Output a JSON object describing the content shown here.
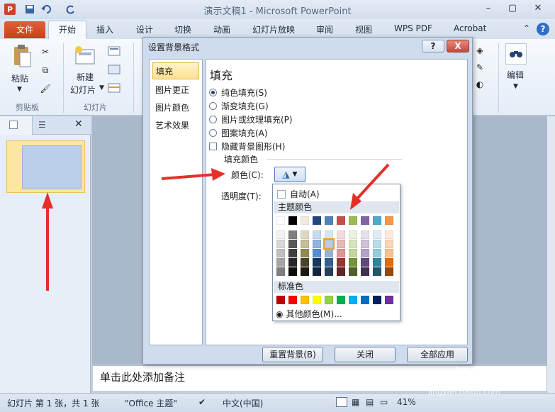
{
  "app": {
    "title": "演示文稿1 - Microsoft PowerPoint",
    "logo": "P"
  },
  "tabs": [
    "文件",
    "开始",
    "插入",
    "设计",
    "切换",
    "动画",
    "幻灯片放映",
    "审阅",
    "视图",
    "WPS PDF",
    "Acrobat"
  ],
  "ribbon": {
    "paste": "粘贴",
    "new_slide_1": "新建",
    "new_slide_2": "幻灯片",
    "edit": "编辑",
    "group_clipboard": "剪贴板",
    "group_slides": "幻灯片"
  },
  "dialog": {
    "title": "设置背景格式",
    "help": "?",
    "close": "X",
    "nav": [
      "填充",
      "图片更正",
      "图片颜色",
      "艺术效果"
    ],
    "main_title": "填充",
    "options": [
      "纯色填充(S)",
      "渐变填充(G)",
      "图片或纹理填充(P)",
      "图案填充(A)"
    ],
    "hide_graphics": "隐藏背景图形(H)",
    "fill_color_section": "填充颜色",
    "color_label": "颜色(C):",
    "transparency_label": "透明度(T):",
    "btn_reset": "重置背景(B)",
    "btn_close": "关闭",
    "btn_apply_all": "全部应用"
  },
  "palette": {
    "auto": "自动(A)",
    "theme_colors": "主题颜色",
    "standard_colors": "标准色",
    "more_colors": "其他颜色(M)...",
    "theme_top": [
      "#ffffff",
      "#000000",
      "#eeece1",
      "#1f497d",
      "#4f81bd",
      "#c0504d",
      "#9bbb59",
      "#8064a2",
      "#4bacc6",
      "#f79646"
    ],
    "theme_shades": [
      [
        "#f2f2f2",
        "#7f7f7f",
        "#ddd9c3",
        "#c6d9f0",
        "#dbe5f1",
        "#f2dcdb",
        "#ebf1dd",
        "#e5e0ec",
        "#dbeef3",
        "#fdeada"
      ],
      [
        "#d8d8d8",
        "#595959",
        "#c4bd97",
        "#8db3e2",
        "#b8cce4",
        "#e5b9b7",
        "#d7e3bc",
        "#ccc1d9",
        "#b7dde8",
        "#fbd5b5"
      ],
      [
        "#bfbfbf",
        "#3f3f3f",
        "#938953",
        "#548dd4",
        "#95b3d7",
        "#d99694",
        "#c3d69b",
        "#b2a2c7",
        "#92cddc",
        "#fac08f"
      ],
      [
        "#a5a5a5",
        "#262626",
        "#494429",
        "#17365d",
        "#366092",
        "#953734",
        "#76923c",
        "#5f497a",
        "#31859b",
        "#e36c09"
      ],
      [
        "#7f7f7f",
        "#0c0c0c",
        "#1d1b10",
        "#0f243e",
        "#244061",
        "#632423",
        "#4f6128",
        "#3f3151",
        "#205867",
        "#974806"
      ]
    ],
    "standard": [
      "#c00000",
      "#ff0000",
      "#ffc000",
      "#ffff00",
      "#92d050",
      "#00b050",
      "#00b0f0",
      "#0070c0",
      "#002060",
      "#7030a0"
    ]
  },
  "slides": {
    "number": "1"
  },
  "notes": {
    "placeholder": "单击此处添加备注"
  },
  "status": {
    "slide_info": "幻灯片 第 1 张，共 1 张",
    "theme": "\"Office 主题\"",
    "language": "中文(中国)",
    "zoom": "41%"
  },
  "watermark": {
    "main": "Bai 经验",
    "sub": "jingyan.baidu.com"
  },
  "colors": {
    "accent": "#e5302a",
    "selected": "#fde091"
  }
}
